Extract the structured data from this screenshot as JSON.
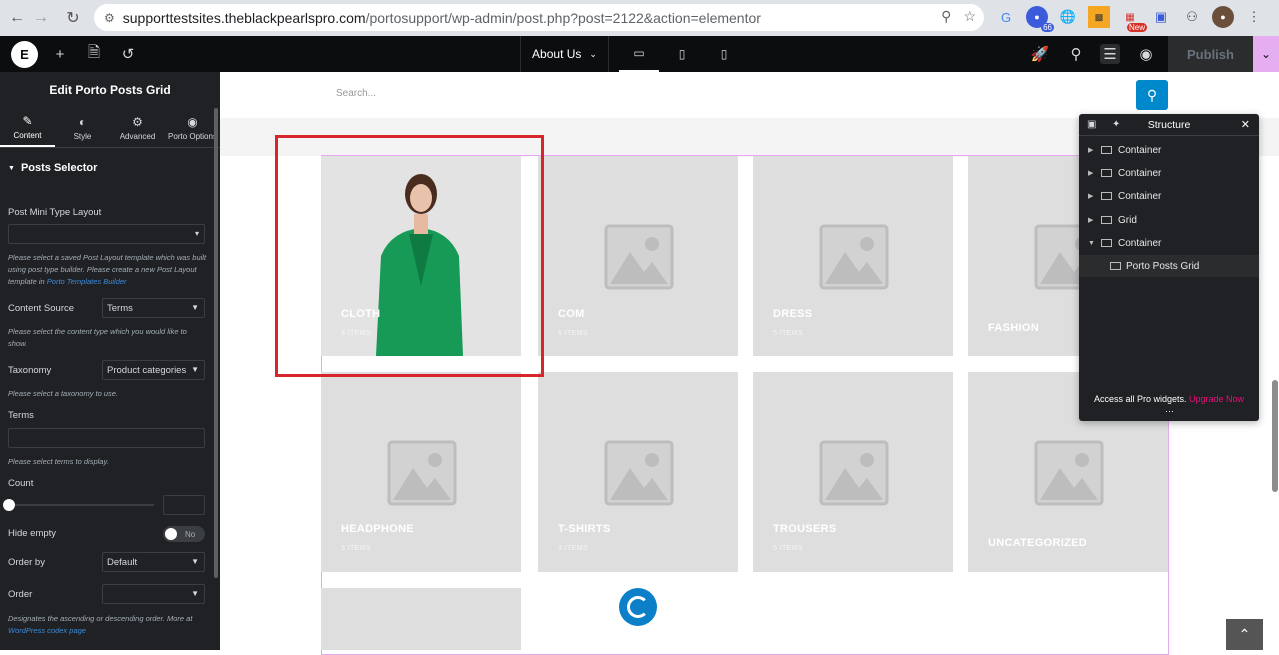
{
  "browser": {
    "url_host": "supporttestsites.theblackpearlspro.com",
    "url_path": "/portosupport/wp-admin/post.php?post=2122&action=elementor",
    "ext_badge_1": "66",
    "ext_badge_2": "New"
  },
  "topbar": {
    "page_name": "About Us",
    "publish_label": "Publish"
  },
  "panel": {
    "title": "Edit Porto Posts Grid",
    "tabs": [
      {
        "label": "Content"
      },
      {
        "label": "Style"
      },
      {
        "label": "Advanced"
      },
      {
        "label": "Porto Options"
      }
    ],
    "section_title": "Posts Selector",
    "post_mini_type_label": "Post Mini Type Layout",
    "post_mini_type_help": "Please select a saved Post Layout template which was built using post type builder. Please create a new Post Layout template in",
    "post_mini_type_link": "Porto Templates Builder",
    "content_source_label": "Content Source",
    "content_source_value": "Terms",
    "content_source_help": "Please select the content type which you would like to show.",
    "taxonomy_label": "Taxonomy",
    "taxonomy_value": "Product categories",
    "taxonomy_help": "Please select a taxonomy to use.",
    "terms_label": "Terms",
    "terms_help": "Please select terms to display.",
    "count_label": "Count",
    "hide_empty_label": "Hide empty",
    "hide_empty_value": "No",
    "order_by_label": "Order by",
    "order_by_value": "Default",
    "order_label": "Order",
    "order_help": "Designates the ascending or descending order. More at",
    "order_help_link": "WordPress codex page"
  },
  "canvas": {
    "search_placeholder": "Search...",
    "tiles": [
      {
        "name": "CLOTH",
        "count": "3 ITEMS"
      },
      {
        "name": "COM",
        "count": "5 ITEMS"
      },
      {
        "name": "DRESS",
        "count": "5 ITEMS"
      },
      {
        "name": "FASHION",
        "count": ""
      },
      {
        "name": "HEADPHONE",
        "count": "3 ITEMS"
      },
      {
        "name": "T-SHIRTS",
        "count": "3 ITEMS"
      },
      {
        "name": "TROUSERS",
        "count": "5 ITEMS"
      },
      {
        "name": "UNCATEGORIZED",
        "count": ""
      }
    ]
  },
  "structure": {
    "title": "Structure",
    "items": [
      {
        "label": "Container"
      },
      {
        "label": "Container"
      },
      {
        "label": "Container"
      },
      {
        "label": "Grid"
      },
      {
        "label": "Container"
      },
      {
        "label": "Porto Posts Grid"
      }
    ],
    "upgrade_text": "Access all Pro widgets.",
    "upgrade_link": "Upgrade Now"
  },
  "colors": {
    "accent": "#0088cc",
    "highlight": "#d7262b",
    "pink": "#e6a9f1"
  }
}
